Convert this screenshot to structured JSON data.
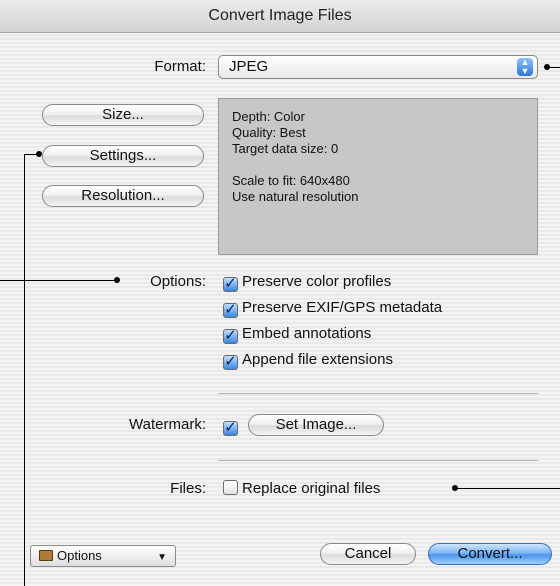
{
  "window": {
    "title": "Convert Image Files"
  },
  "format": {
    "label": "Format:",
    "value": "JPEG"
  },
  "buttons": {
    "size": "Size...",
    "settings": "Settings...",
    "resolution": "Resolution...",
    "set_image": "Set Image...",
    "cancel": "Cancel",
    "convert": "Convert..."
  },
  "info": {
    "depth": "Depth: Color",
    "quality": "Quality: Best",
    "target": "Target data size: 0",
    "scale": "Scale to fit: 640x480",
    "natural": "Use natural resolution"
  },
  "options": {
    "label": "Options:",
    "items": [
      {
        "label": "Preserve color profiles",
        "checked": true
      },
      {
        "label": "Preserve EXIF/GPS metadata",
        "checked": true
      },
      {
        "label": "Embed annotations",
        "checked": true
      },
      {
        "label": "Append file extensions",
        "checked": true
      }
    ]
  },
  "watermark": {
    "label": "Watermark:",
    "checked": true
  },
  "files": {
    "label": "Files:",
    "replace_label": "Replace original files",
    "checked": false
  },
  "action_menu": {
    "label": "Options"
  },
  "colors": {
    "accent": "#4b94ec",
    "info_bg": "#c7c7c7"
  }
}
